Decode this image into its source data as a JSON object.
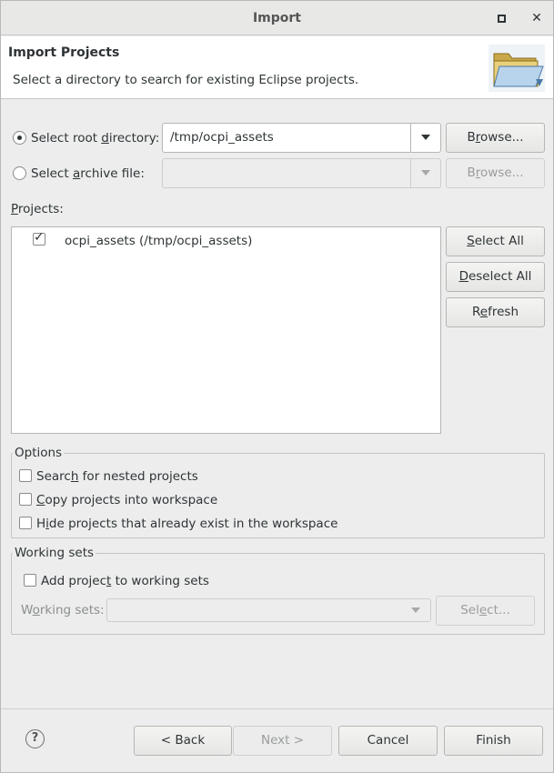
{
  "window": {
    "title": "Import"
  },
  "banner": {
    "heading": "Import Projects",
    "description": "Select a directory to search for existing Eclipse projects."
  },
  "source": {
    "root_label_pre": "Select root ",
    "root_label_u": "d",
    "root_label_post": "irectory:",
    "root_selected": true,
    "root_value": "/tmp/ocpi_assets",
    "archive_label_pre": "Select ",
    "archive_label_u": "a",
    "archive_label_post": "rchive file:",
    "archive_value": "",
    "browse_root_pre": "B",
    "browse_root_u": "r",
    "browse_root_post": "owse...",
    "browse_archive_pre": "B",
    "browse_archive_u": "r",
    "browse_archive_post": "owse..."
  },
  "projects": {
    "label_u": "P",
    "label_post": "rojects:",
    "items": [
      {
        "name": "ocpi_assets (/tmp/ocpi_assets)",
        "checked": true
      }
    ],
    "select_all_u": "S",
    "select_all_post": "elect All",
    "deselect_all_u": "D",
    "deselect_all_post": "eselect All",
    "refresh_pre": "R",
    "refresh_u": "e",
    "refresh_post": "fresh"
  },
  "options": {
    "title": "Options",
    "search_pre": "Searc",
    "search_u": "h",
    "search_post": " for nested projects",
    "copy_u": "C",
    "copy_post": "opy projects into workspace",
    "hide_pre": "H",
    "hide_u": "i",
    "hide_post": "de projects that already exist in the workspace"
  },
  "working_sets": {
    "title": "Working sets",
    "add_pre": "Add projec",
    "add_u": "t",
    "add_post": " to working sets",
    "label_pre": "W",
    "label_u": "o",
    "label_post": "rking sets:",
    "value": "",
    "select_pre": "Sel",
    "select_u": "e",
    "select_post": "ct..."
  },
  "footer": {
    "help": "?",
    "back": "< Back",
    "next": "Next >",
    "cancel": "Cancel",
    "finish": "Finish"
  }
}
